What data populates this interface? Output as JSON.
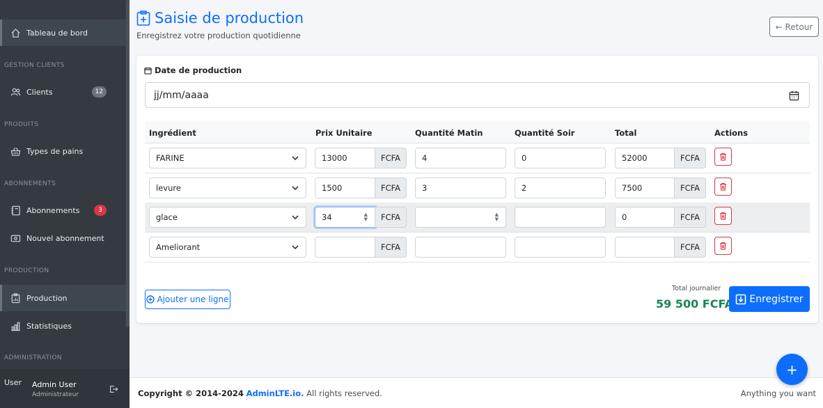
{
  "sidebar": {
    "dashboard": "Tableau de bord",
    "sections": {
      "clients": "GESTION CLIENTS",
      "produits": "PRODUITS",
      "abonnements": "ABONNEMENTS",
      "production": "PRODUCTION",
      "administration": "ADMINISTRATION"
    },
    "items": {
      "clients": "Clients",
      "clients_badge": "12",
      "types_pains": "Types de pains",
      "abonnements": "Abonnements",
      "abonnements_badge": "3",
      "nouvel_abonnement": "Nouvel abonnement",
      "production": "Production",
      "statistiques": "Statistiques"
    },
    "user": {
      "avatar_alt": "User",
      "name": "Admin User",
      "role": "Administrateur"
    }
  },
  "header": {
    "title": "Saisie de production",
    "subtitle": "Enregistrez votre production quotidienne",
    "back": "← Retour"
  },
  "form": {
    "date_label": "Date de production",
    "date_placeholder": "jj/mm/aaaa",
    "columns": [
      "Ingrédient",
      "Prix Unitaire",
      "Quantité Matin",
      "Quantité Soir",
      "Total",
      "Actions"
    ],
    "currency": "FCFA",
    "rows": [
      {
        "ingredient": "FARINE",
        "prix": "13000",
        "matin": "4",
        "soir": "0",
        "total": "52000"
      },
      {
        "ingredient": "levure",
        "prix": "1500",
        "matin": "3",
        "soir": "2",
        "total": "7500"
      },
      {
        "ingredient": "glace",
        "prix": "34",
        "matin": "",
        "soir": "",
        "total": "0"
      },
      {
        "ingredient": "Ameliorant",
        "prix": "",
        "matin": "",
        "soir": "",
        "total": ""
      }
    ],
    "add_line": "Ajouter une ligne",
    "total_label": "Total journalier",
    "total_value": "59 500 FCFA",
    "save": "Enregistrer"
  },
  "footer": {
    "copyright": "Copyright © 2014-2024",
    "brand": "AdminLTE.io.",
    "rights": "All rights reserved.",
    "right": "Anything you want"
  },
  "fab": "+",
  "colors": {
    "primary": "#0d6efd",
    "success": "#198754",
    "danger": "#dc3545",
    "sidebar": "#343a40"
  }
}
